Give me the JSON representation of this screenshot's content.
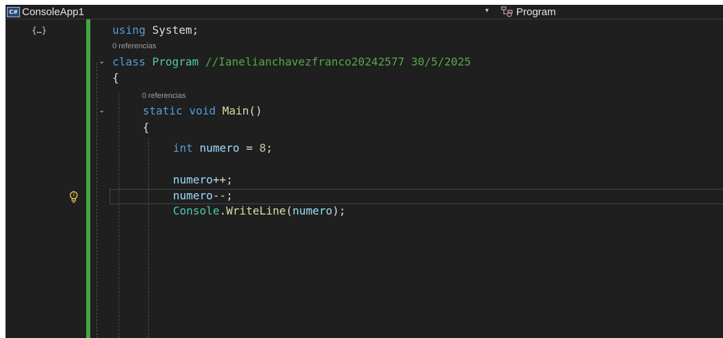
{
  "navbar": {
    "project_badge": "C#",
    "project": "ConsoleApp1",
    "dropdown_arrow": "▾",
    "class_name": "Program",
    "class_icon": "class-icon"
  },
  "code": {
    "line1": {
      "kw": "using",
      "name": "System",
      "semi": ";"
    },
    "lens1": "0 referencias",
    "line2": {
      "kw": "class",
      "name": "Program",
      "comment": "//Ianelianchavezfranco20242577 30/5/2025"
    },
    "line3": "{",
    "lens2": "0 referencias",
    "line4": {
      "kw1": "static",
      "kw2": "void",
      "fn": "Main",
      "rest": "()"
    },
    "line5": "{",
    "line6": {
      "kw": "int",
      "var": "numero",
      "op": "=",
      "num": "8",
      "semi": ";"
    },
    "line7": {
      "var": "numero",
      "op": "++;"
    },
    "line8": {
      "var": "numero",
      "op": "--;"
    },
    "line9": {
      "type": "Console",
      "dot": ".",
      "fn": "WriteLine",
      "open": "(",
      "arg": "numero",
      "close": ");"
    }
  },
  "gutter": {
    "scope_icon": "scope-icon",
    "bulb_icon": "lightbulb-icon",
    "fold_glyph": "⌄"
  },
  "colors": {
    "background": "#1f1f1f",
    "change_bar": "#3fa93f",
    "keyword": "#569cd6",
    "type": "#4ec9b0",
    "identifier": "#9cdcfe",
    "function": "#dcdcaa",
    "number": "#b5cea8",
    "comment": "#57a64a"
  }
}
